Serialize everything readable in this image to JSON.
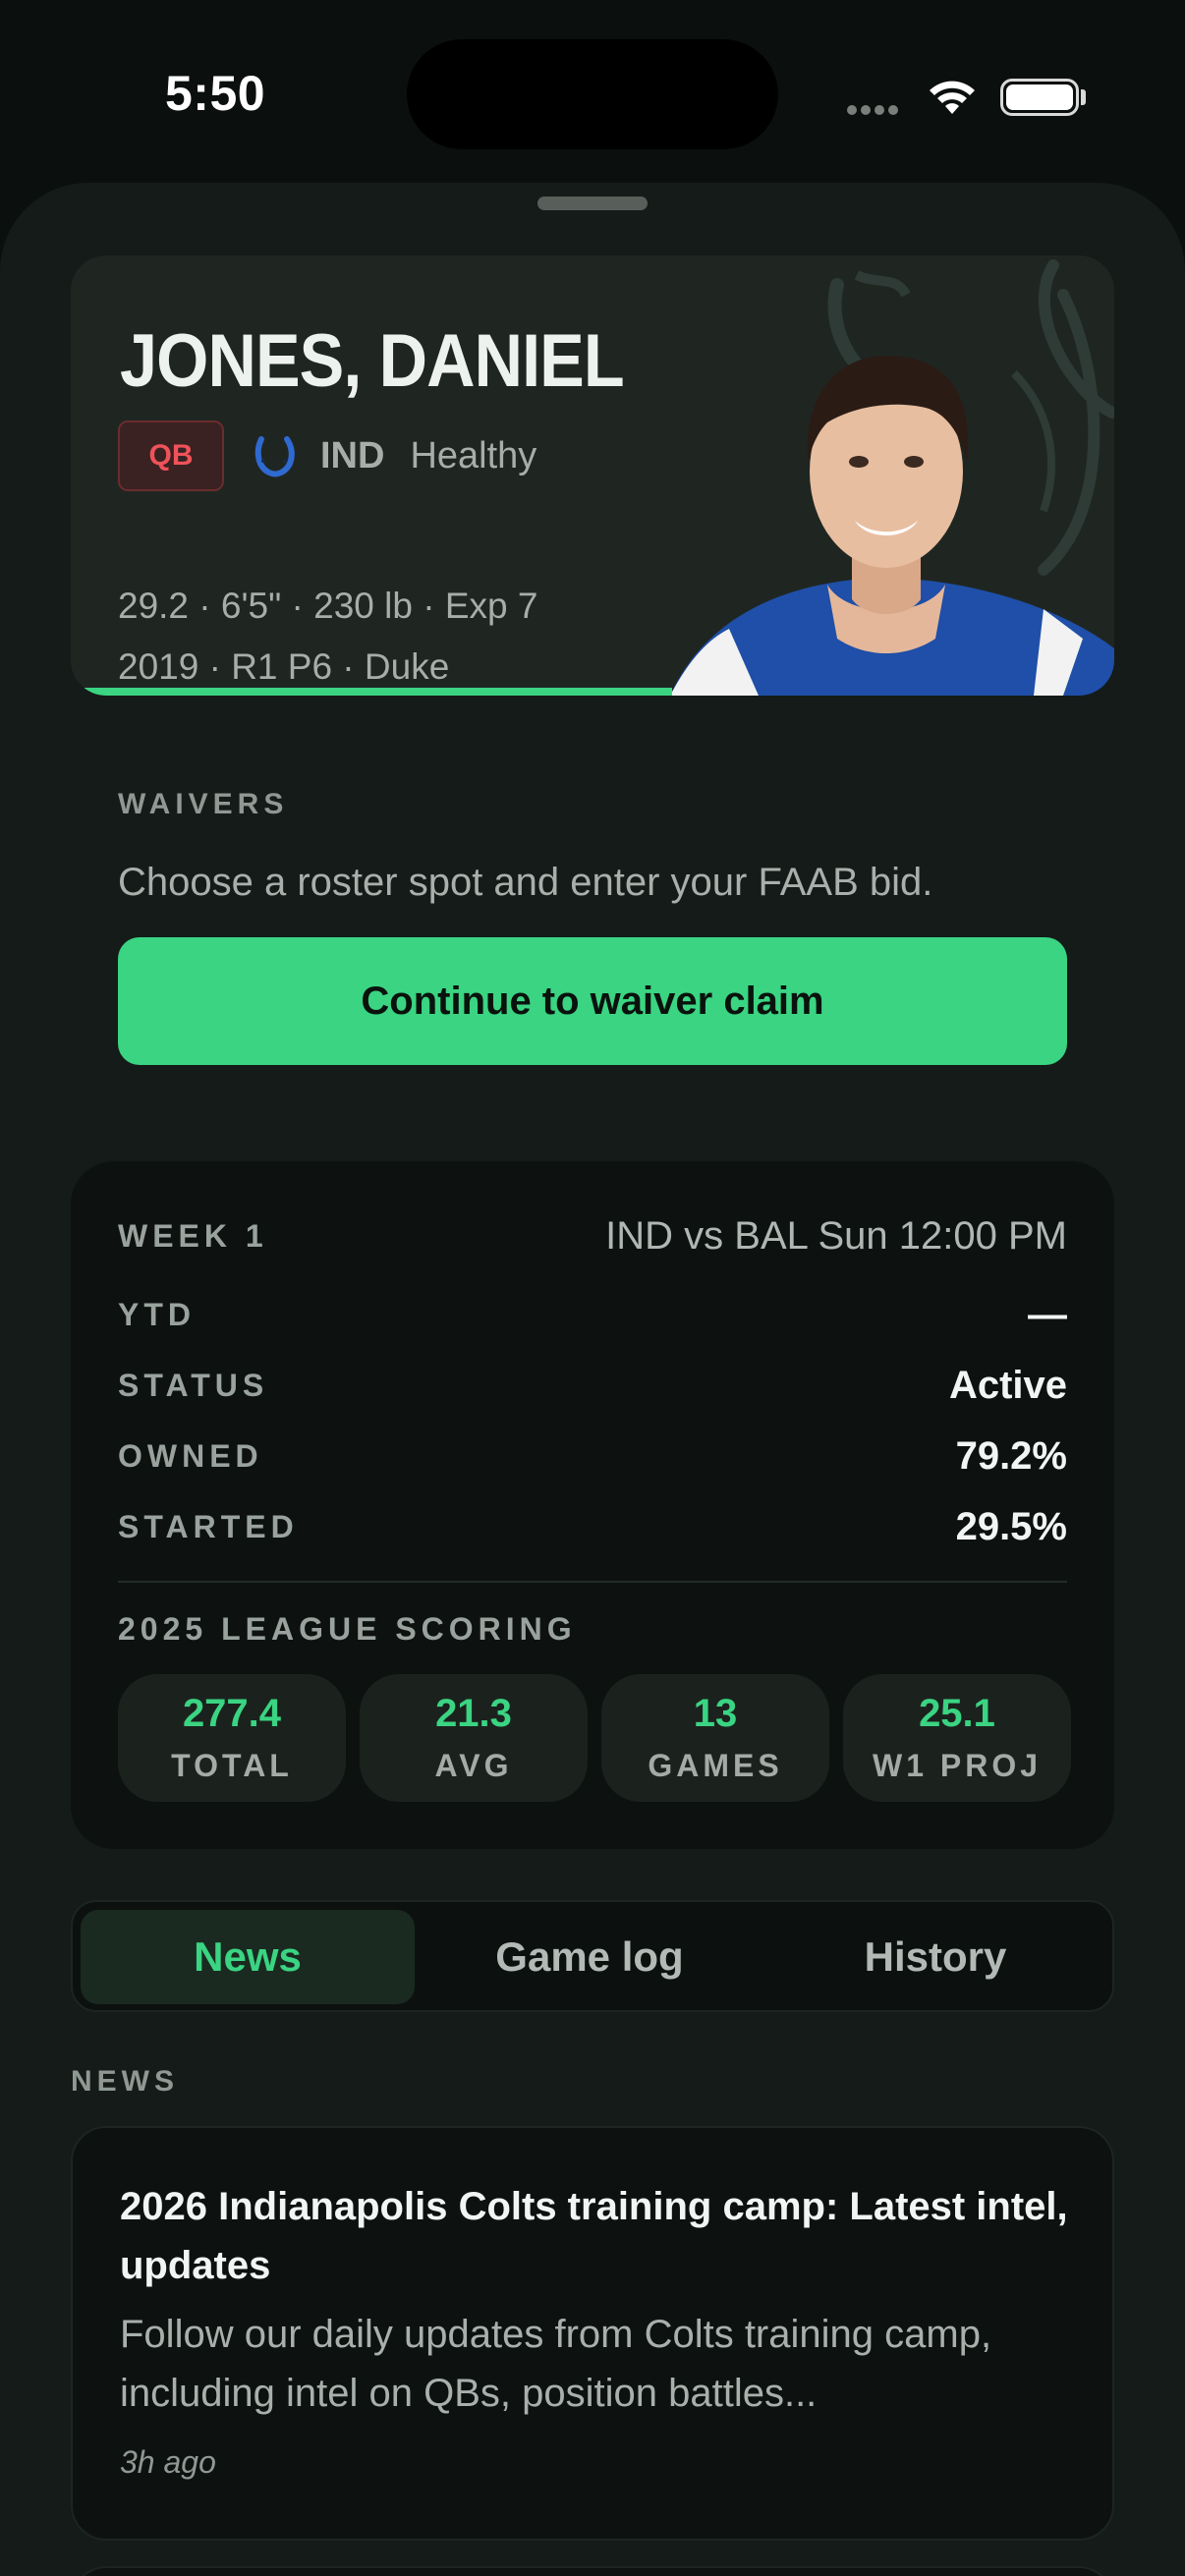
{
  "status_bar": {
    "time": "5:50"
  },
  "player": {
    "name": "JONES, DANIEL",
    "position": "QB",
    "team": "IND",
    "health": "Healthy",
    "bio_line1": "29.2 · 6'5\" · 230 lb · Exp 7",
    "bio_line2": "2019 · R1 P6 · Duke",
    "accent_color": "#3ad482",
    "position_color": "#f0525a"
  },
  "waivers": {
    "label": "WAIVERS",
    "description": "Choose a roster spot and enter your FAAB bid.",
    "button_label": "Continue to waiver claim"
  },
  "stats": {
    "week_label": "WEEK 1",
    "matchup": "IND vs BAL Sun 12:00 PM",
    "rows": [
      {
        "label": "YTD",
        "value": "—"
      },
      {
        "label": "STATUS",
        "value": "Active"
      },
      {
        "label": "OWNED",
        "value": "79.2%"
      },
      {
        "label": "STARTED",
        "value": "29.5%"
      }
    ],
    "scoring_label": "2025 LEAGUE SCORING",
    "tiles": [
      {
        "value": "277.4",
        "label": "TOTAL"
      },
      {
        "value": "21.3",
        "label": "AVG"
      },
      {
        "value": "13",
        "label": "GAMES"
      },
      {
        "value": "25.1",
        "label": "W1 PROJ"
      }
    ]
  },
  "tabs": [
    {
      "label": "News",
      "active": true
    },
    {
      "label": "Game log",
      "active": false
    },
    {
      "label": "History",
      "active": false
    }
  ],
  "news": {
    "section_label": "NEWS",
    "items": [
      {
        "title": "2026 Indianapolis Colts training camp: Latest intel, updates",
        "summary": "Follow our daily updates from Colts training camp, including intel on QBs, position battles...",
        "time": "3h ago"
      }
    ]
  },
  "icons": {
    "team_logo": "colts-horseshoe-icon",
    "wifi": "wifi-icon",
    "battery": "battery-icon",
    "signal": "cellular-signal-icon"
  }
}
